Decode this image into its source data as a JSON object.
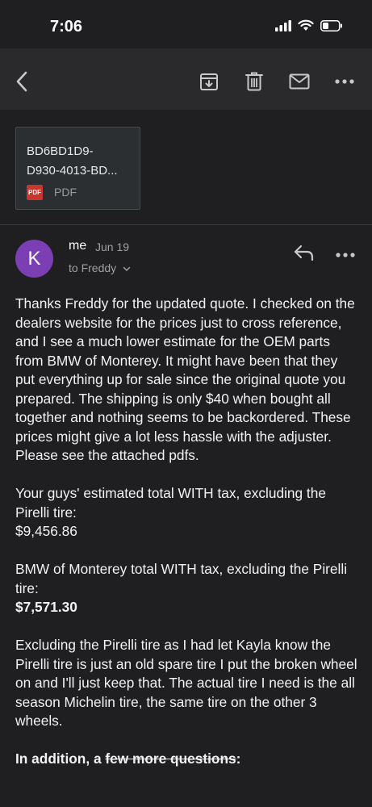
{
  "status_bar": {
    "time": "7:06",
    "icons": [
      "signal-icon",
      "wifi-icon",
      "battery-icon"
    ]
  },
  "toolbar": {
    "back_icon": "back-chevron-icon",
    "archive_icon": "archive-icon",
    "delete_icon": "trash-icon",
    "mark_unread_icon": "mail-icon",
    "more_icon": "more-dots-icon"
  },
  "attachment": {
    "name_line1": "BD6BD1D9-",
    "name_line2": "D930-4013-BD...",
    "badge": "PDF",
    "type_label": "PDF"
  },
  "message": {
    "avatar_letter": "K",
    "sender": "me",
    "date": "Jun 19",
    "recipient": "to Freddy",
    "reply_icon": "reply-icon",
    "more_icon": "more-dots-icon"
  },
  "body": {
    "p1": "Thanks Freddy for the updated quote. I checked on the dealers website for the prices just to cross reference, and I see a much lower estimate for the OEM parts from BMW of Monterey. It might have been that they put everything up for sale since the original quote you prepared. The shipping is only $40 when bought all together and nothing seems to be backordered. These prices might give a lot less hassle with the adjuster. Please see the attached pdfs.",
    "p2_label": "Your guys' estimated total WITH tax, excluding the Pirelli tire:",
    "p2_value": "$9,456.86",
    "p3_label": "BMW of Monterey total WITH tax, excluding the Pirelli tire:",
    "p3_value": "$7,571.30",
    "p4": "Excluding the Pirelli tire as I had let Kayla know the Pirelli tire is just an old spare tire I put the broken wheel on and I'll just keep that. The actual tire I need is the all season Michelin tire, the same tire on the other 3 wheels.",
    "p5_prefix": "In addition, a ",
    "p5_strike": "few more questions",
    "p5_suffix": ":"
  },
  "colors": {
    "background": "#1f1f21",
    "toolbar": "#2a2a2d",
    "avatar": "#7b3fb3",
    "pdf_badge": "#c8372d"
  }
}
